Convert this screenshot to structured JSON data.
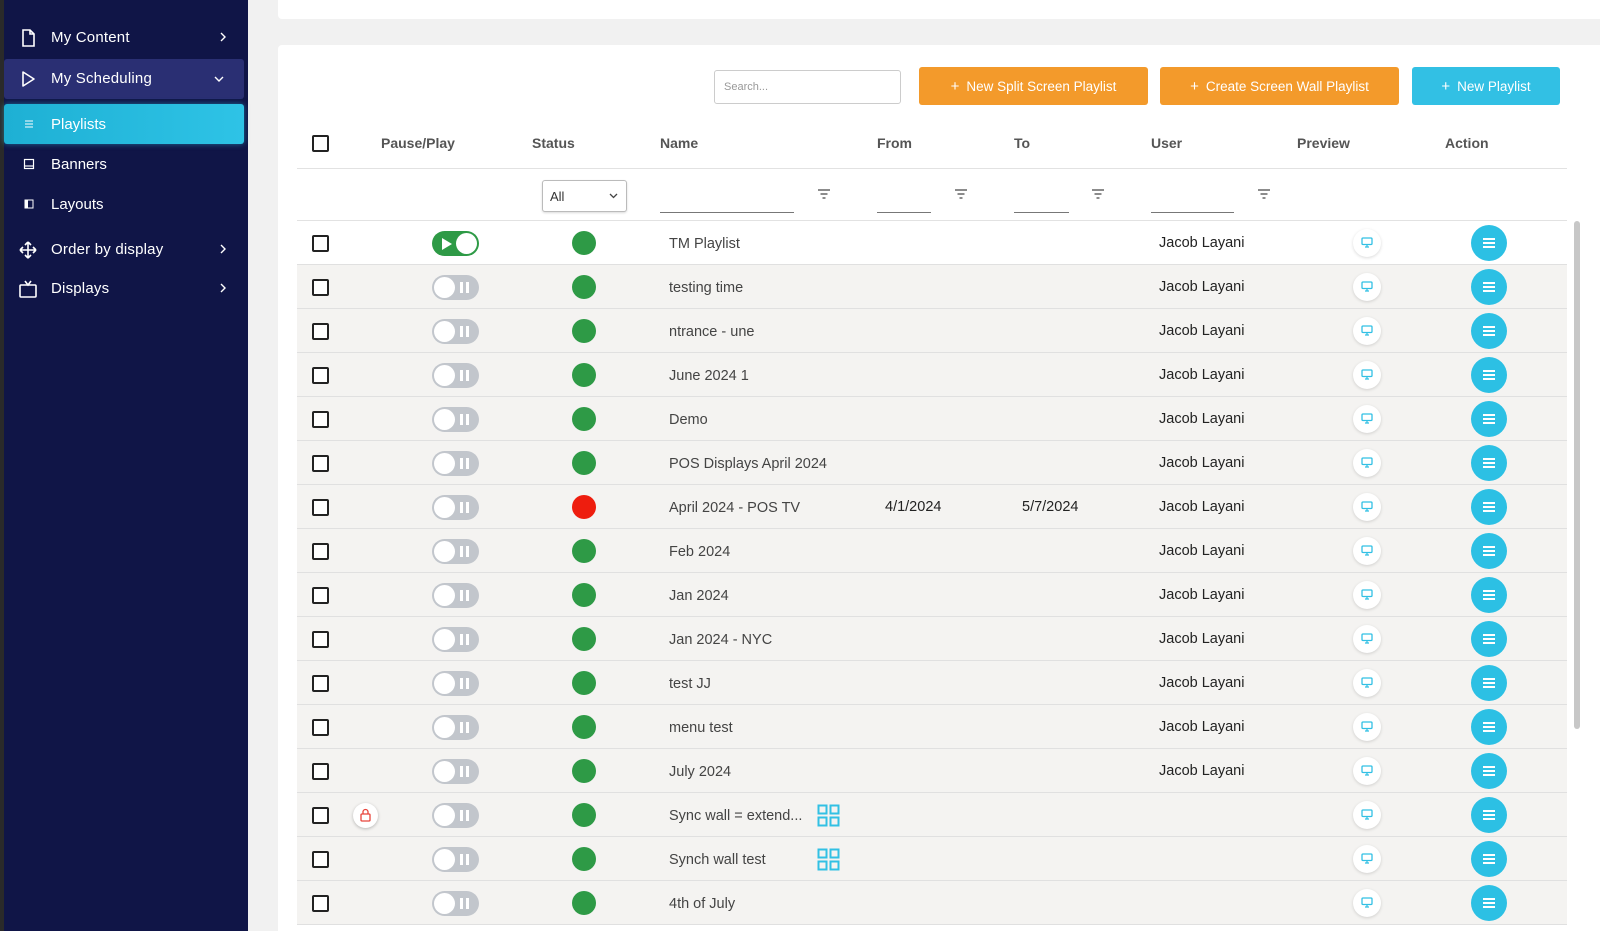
{
  "sidebar": {
    "items": [
      {
        "label": "My Content",
        "icon": "document-icon"
      },
      {
        "label": "My Scheduling",
        "icon": "play-icon"
      },
      {
        "label": "Playlists",
        "icon": "list-icon"
      },
      {
        "label": "Banners",
        "icon": "banner-icon"
      },
      {
        "label": "Layouts",
        "icon": "layout-icon"
      },
      {
        "label": "Order by display",
        "icon": "move-icon"
      },
      {
        "label": "Displays",
        "icon": "tv-icon"
      }
    ]
  },
  "toolbar": {
    "search_placeholder": "Search...",
    "split_label": "New Split Screen Playlist",
    "wall_label": "Create Screen Wall Playlist",
    "new_label": "New Playlist"
  },
  "columns": {
    "pause": "Pause/Play",
    "status": "Status",
    "name": "Name",
    "from": "From",
    "to": "To",
    "user": "User",
    "preview": "Preview",
    "action": "Action"
  },
  "filters": {
    "status_value": "All"
  },
  "colors": {
    "accent": "#32c0e4",
    "orange": "#f39a2b",
    "sidebar": "#101547",
    "active_green": "#2e9a46",
    "expired_red": "#ee1d0e"
  },
  "rows": [
    {
      "name": "TM Playlist",
      "playing": true,
      "status": "green",
      "from": "",
      "to": "",
      "user": "Jacob Layani",
      "locked": false,
      "wall": false
    },
    {
      "name": "testing time",
      "playing": false,
      "status": "green",
      "from": "",
      "to": "",
      "user": "Jacob Layani",
      "locked": false,
      "wall": false
    },
    {
      "name": "ntrance - une",
      "playing": false,
      "status": "green",
      "from": "",
      "to": "",
      "user": "Jacob Layani",
      "locked": false,
      "wall": false
    },
    {
      "name": "June 2024 1",
      "playing": false,
      "status": "green",
      "from": "",
      "to": "",
      "user": "Jacob Layani",
      "locked": false,
      "wall": false
    },
    {
      "name": "Demo",
      "playing": false,
      "status": "green",
      "from": "",
      "to": "",
      "user": "Jacob Layani",
      "locked": false,
      "wall": false
    },
    {
      "name": "POS Displays April 2024",
      "playing": false,
      "status": "green",
      "from": "",
      "to": "",
      "user": "Jacob Layani",
      "locked": false,
      "wall": false
    },
    {
      "name": "April 2024 - POS TV",
      "playing": false,
      "status": "red",
      "from": "4/1/2024",
      "to": "5/7/2024",
      "user": "Jacob Layani",
      "locked": false,
      "wall": false
    },
    {
      "name": "Feb 2024",
      "playing": false,
      "status": "green",
      "from": "",
      "to": "",
      "user": "Jacob Layani",
      "locked": false,
      "wall": false
    },
    {
      "name": "Jan 2024",
      "playing": false,
      "status": "green",
      "from": "",
      "to": "",
      "user": "Jacob Layani",
      "locked": false,
      "wall": false
    },
    {
      "name": "Jan 2024 - NYC",
      "playing": false,
      "status": "green",
      "from": "",
      "to": "",
      "user": "Jacob Layani",
      "locked": false,
      "wall": false
    },
    {
      "name": "test JJ",
      "playing": false,
      "status": "green",
      "from": "",
      "to": "",
      "user": "Jacob Layani",
      "locked": false,
      "wall": false
    },
    {
      "name": "menu test",
      "playing": false,
      "status": "green",
      "from": "",
      "to": "",
      "user": "Jacob Layani",
      "locked": false,
      "wall": false
    },
    {
      "name": "July 2024",
      "playing": false,
      "status": "green",
      "from": "",
      "to": "",
      "user": "Jacob Layani",
      "locked": false,
      "wall": false
    },
    {
      "name": "Sync wall = extend...",
      "playing": false,
      "status": "green",
      "from": "",
      "to": "",
      "user": "",
      "locked": true,
      "wall": true
    },
    {
      "name": "Synch wall test",
      "playing": false,
      "status": "green",
      "from": "",
      "to": "",
      "user": "",
      "locked": false,
      "wall": true
    },
    {
      "name": "4th of July",
      "playing": false,
      "status": "green",
      "from": "",
      "to": "",
      "user": "",
      "locked": false,
      "wall": false
    }
  ]
}
